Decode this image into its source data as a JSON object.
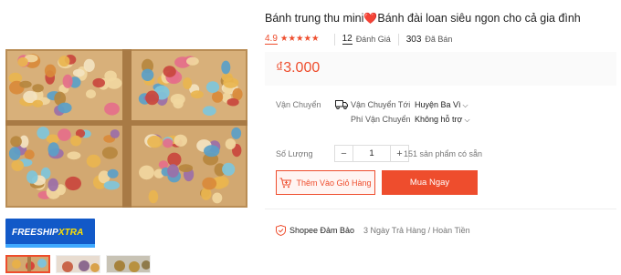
{
  "product": {
    "title": "Bánh trung thu mini",
    "title_emoji": "❤️",
    "title_rest": "Bánh đài loan siêu ngon cho cả gia đình",
    "rating": "4.9",
    "stars": 5,
    "reviews_count": "12",
    "reviews_label": "Đánh Giá",
    "sold_count": "303",
    "sold_label": "Đã Bán",
    "price": "₫3.000"
  },
  "shipping": {
    "label": "Vận Chuyển",
    "to_label": "Vận Chuyển Tới",
    "to_value": "Huyện Ba Vì",
    "fee_label": "Phí Vận Chuyển",
    "fee_value": "Không hỗ trợ"
  },
  "quantity": {
    "label": "Số Lượng",
    "value": "1",
    "minus": "−",
    "plus": "+",
    "stock_text": "151 sản phẩm có sẵn"
  },
  "actions": {
    "add_to_cart": "Thêm Vào Giỏ Hàng",
    "buy_now": "Mua Ngay"
  },
  "guarantee": {
    "title": "Shopee Đảm Bảo",
    "desc": "3 Ngày Trả Hàng / Hoàn Tiền"
  },
  "badge": {
    "freeship": "FREESHIP",
    "xtra": "XTRA"
  },
  "icons": {
    "star": "★",
    "chevron": "chevron-down-icon",
    "truck": "truck-icon",
    "cart": "cart-plus-icon",
    "shield": "shield-icon"
  },
  "colors": {
    "accent": "#ee4d2d",
    "price_bg": "#fafafa",
    "freeship_blue": "#1259c8",
    "xtra_yellow": "#ffe100"
  }
}
